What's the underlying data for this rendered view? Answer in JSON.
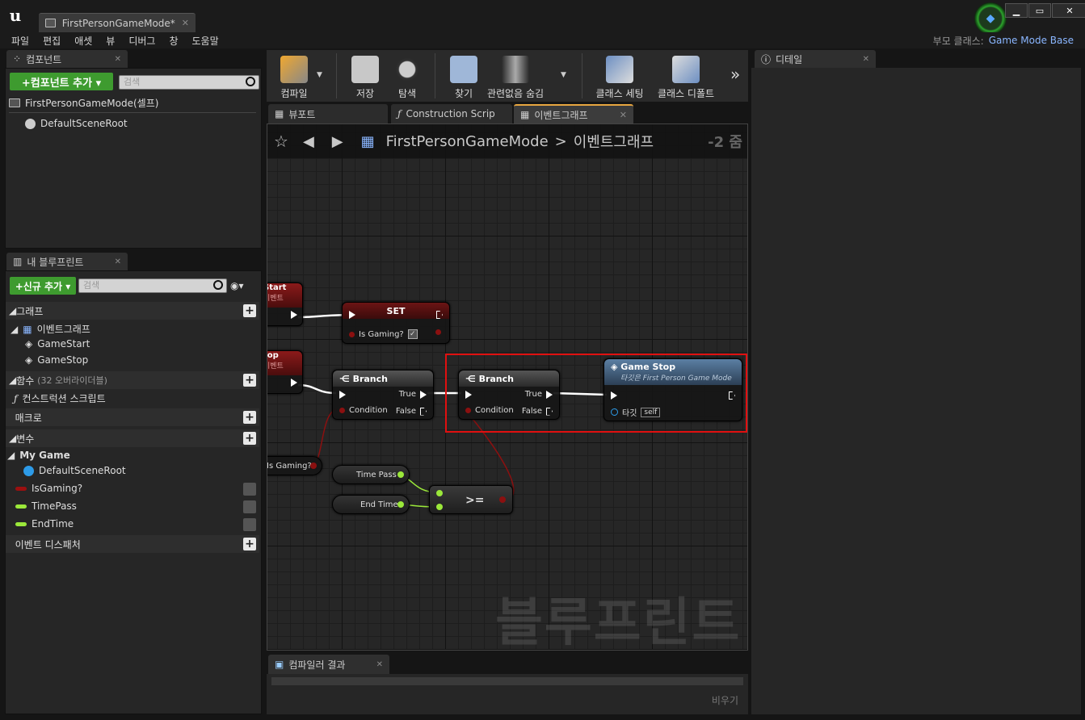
{
  "window": {
    "tab_title": "FirstPersonGameMode*",
    "parent_class_label": "부모 클래스:",
    "parent_class_value": "Game Mode Base",
    "min": "▁",
    "max": "▭",
    "close": "✕"
  },
  "menu": [
    "파일",
    "편집",
    "애셋",
    "뷰",
    "디버그",
    "창",
    "도움말"
  ],
  "components": {
    "tab": "컴포넌트",
    "add_button": "+컴포넌트 추가 ▾",
    "search_placeholder": "검색",
    "root": "FirstPersonGameMode(셀프)",
    "child": "DefaultSceneRoot"
  },
  "my_blueprint": {
    "tab": "내 블루프린트",
    "add_button": "+신규 추가 ▾",
    "search_placeholder": "검색",
    "graphs": "그래프",
    "event_graph": "이벤트그래프",
    "events": [
      "GameStart",
      "GameStop"
    ],
    "functions": "함수",
    "functions_note": "(32 오버라이더블)",
    "construction": "컨스트럭션 스크립트",
    "macros": "매크로",
    "variables": "변수",
    "group": "My Game",
    "vars": [
      "DefaultSceneRoot",
      "IsGaming?",
      "TimePass",
      "EndTime"
    ],
    "dispatchers": "이벤트 디스패처"
  },
  "toolbar": {
    "items": [
      "컴파일",
      "저장",
      "탐색",
      "찾기",
      "관련없음 숨김",
      "클래스 세팅",
      "클래스 디폴트"
    ]
  },
  "graph_tabs": [
    "뷰포트",
    "Construction Scrip",
    "이벤트그래프"
  ],
  "graph": {
    "breadcrumb_root": "FirstPersonGameMode",
    "breadcrumb_sep": ">",
    "breadcrumb_leaf": "이벤트그래프",
    "zoom": "-2 줌",
    "watermark": "블루프린트",
    "nodes": {
      "start_partial": "Start",
      "start_sub": "이벤트",
      "set_title": "SET",
      "set_var": "Is Gaming?",
      "stop_partial": "top",
      "stop_sub": "이벤트",
      "branch1": "Branch",
      "branch2": "Branch",
      "true_label": "True",
      "false_label": "False",
      "condition": "Condition",
      "gamestop_title": "Game Stop",
      "gamestop_sub": "타깃은 First Person Game Mode",
      "target": "타깃",
      "self": "self",
      "isgaming_get": "Is Gaming?",
      "timepass": "Time Pass",
      "endtime": "End Time",
      "compare": ">="
    }
  },
  "compiler": {
    "tab": "컴파일러 결과",
    "clear": "비우기"
  },
  "details": {
    "tab": "디테일"
  }
}
